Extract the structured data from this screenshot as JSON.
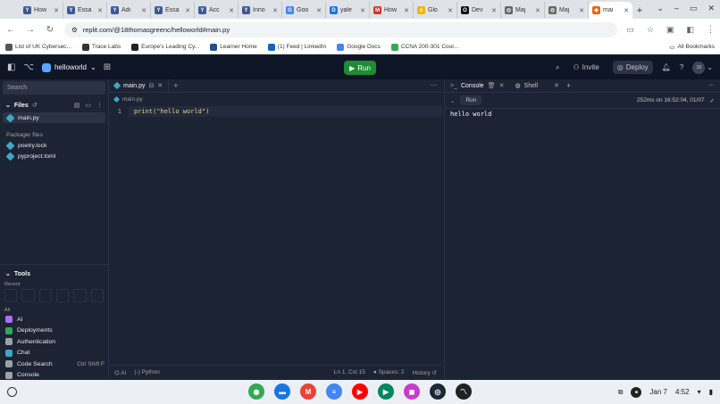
{
  "browser": {
    "tabs": [
      {
        "title": "How",
        "favicon": "Y",
        "color": "#3b5998"
      },
      {
        "title": "Essa",
        "favicon": "Y",
        "color": "#3b5998"
      },
      {
        "title": "Adi",
        "favicon": "Y",
        "color": "#3b5998"
      },
      {
        "title": "Essa",
        "favicon": "Y",
        "color": "#3b5998"
      },
      {
        "title": "Acc",
        "favicon": "Y",
        "color": "#3b5998"
      },
      {
        "title": "Inno",
        "favicon": "Y",
        "color": "#3b5998"
      },
      {
        "title": "Goo",
        "favicon": "G",
        "color": "#4285f4"
      },
      {
        "title": "yale",
        "favicon": "D",
        "color": "#1a73e8"
      },
      {
        "title": "How",
        "favicon": "M",
        "color": "#d93025"
      },
      {
        "title": "Glo",
        "favicon": "☆",
        "color": "#f2b400"
      },
      {
        "title": "Dev",
        "favicon": "O",
        "color": "#111111"
      },
      {
        "title": "Maj",
        "favicon": "◎",
        "color": "#666666"
      },
      {
        "title": "Maj",
        "favicon": "◎",
        "color": "#666666"
      },
      {
        "title": "mai",
        "favicon": "◆",
        "color": "#f26207"
      }
    ],
    "url": "replit.com/@18thomasgreenc/helloworld#main.py",
    "bookmarks": [
      {
        "label": "List of UK Cybersec...",
        "color": "#555"
      },
      {
        "label": "Trace Labs",
        "color": "#333"
      },
      {
        "label": "Europe's Leading Cy...",
        "color": "#222"
      },
      {
        "label": "Learner Home",
        "color": "#1e4f8c"
      },
      {
        "label": "(1) Feed | LinkedIn",
        "color": "#0a66c2"
      },
      {
        "label": "Google Docs",
        "color": "#4285f4"
      },
      {
        "label": "CCNA 200-301 Cour...",
        "color": "#34a853"
      }
    ],
    "all_bookmarks": "All Bookmarks"
  },
  "replit": {
    "project": "helloworld",
    "run_label": "Run",
    "invite_label": "Invite",
    "deploy_label": "Deploy",
    "avatar": "18"
  },
  "sidebar": {
    "search_placeholder": "Search",
    "files_header": "Files",
    "files": [
      {
        "name": "main.py",
        "selected": true
      }
    ],
    "packager_label": "Packager files",
    "packager_files": [
      {
        "name": "poetry.lock"
      },
      {
        "name": "pyproject.toml"
      }
    ],
    "tools_header": "Tools",
    "recent_label": "Recent",
    "all_label": "All",
    "tools": [
      {
        "name": "AI",
        "color": "#a970ff",
        "shortcut": ""
      },
      {
        "name": "Deployments",
        "color": "#2bab5a",
        "shortcut": ""
      },
      {
        "name": "Authentication",
        "color": "#9da2a6",
        "shortcut": ""
      },
      {
        "name": "Chat",
        "color": "#3ea7c4",
        "shortcut": ""
      },
      {
        "name": "Code Search",
        "color": "#9da2a6",
        "shortcut": "Ctrl Shift F"
      },
      {
        "name": "Console",
        "color": "#9da2a6",
        "shortcut": ""
      }
    ]
  },
  "editor": {
    "tab_label": "main.py",
    "breadcrumb": "main.py",
    "line_number": "1",
    "code": "print(\"hello world\")",
    "status_ai": "AI",
    "status_lang": "Python",
    "status_pos": "Ln 1, Col 15",
    "status_spaces": "Spaces: 2",
    "status_history": "History"
  },
  "console": {
    "tab_console": "Console",
    "tab_shell": "Shell",
    "run_label": "Run",
    "timing": "252ms on 16:52:04, 01/07",
    "output": "hello world"
  },
  "taskbar": {
    "apps": [
      {
        "name": "Chrome",
        "color": "#34a853",
        "glyph": "◉"
      },
      {
        "name": "Files",
        "color": "#1a73e8",
        "glyph": "▬"
      },
      {
        "name": "Gmail",
        "color": "#ea4335",
        "glyph": "M"
      },
      {
        "name": "Docs",
        "color": "#4285f4",
        "glyph": "≡"
      },
      {
        "name": "YouTube",
        "color": "#ff0000",
        "glyph": "▶"
      },
      {
        "name": "Play Store",
        "color": "#01875f",
        "glyph": "▶"
      },
      {
        "name": "Gallery",
        "color": "#c93cc9",
        "glyph": "◼"
      },
      {
        "name": "Steam",
        "color": "#1b2838",
        "glyph": "◎"
      },
      {
        "name": "Stocks",
        "color": "#202124",
        "glyph": "〽"
      }
    ],
    "date": "Jan 7",
    "time": "4:52"
  }
}
